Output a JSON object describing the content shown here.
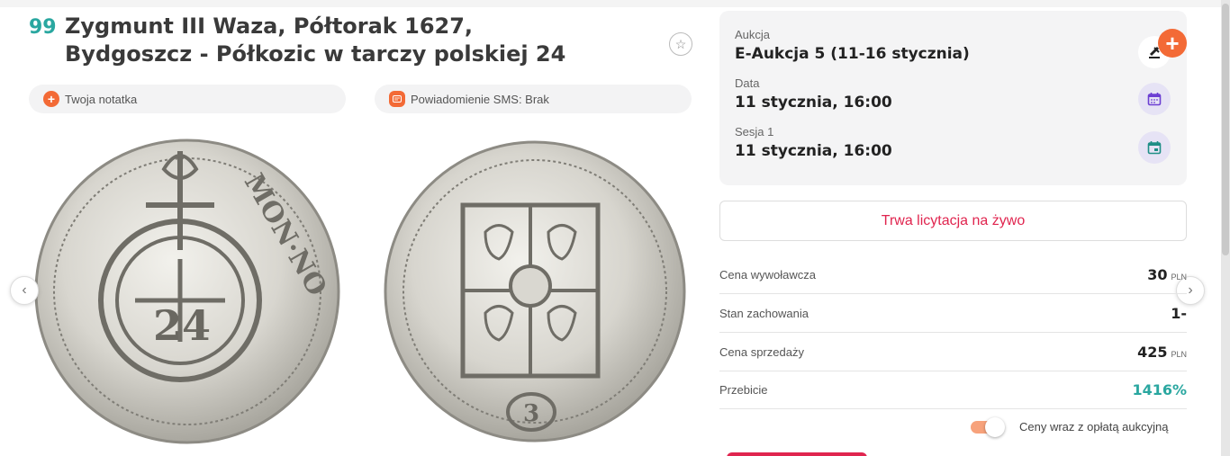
{
  "lot": {
    "number": "99",
    "title_line1": "Zygmunt III Waza, Półtorak 1627,",
    "title_line2": "Bydgoszcz - Półkozic w tarczy polskiej 24"
  },
  "actions": {
    "note_label": "Twoja notatka",
    "sms_label": "Powiadomienie SMS: Brak"
  },
  "images": {
    "obverse": "coin-obverse",
    "reverse": "coin-reverse"
  },
  "auction": {
    "auction_label": "Aukcja",
    "auction_value": "E-Aukcja 5 (11-16 stycznia)",
    "date_label": "Data",
    "date_value": "11 stycznia, 16:00",
    "session_label": "Sesja 1",
    "session_value": "11 stycznia, 16:00"
  },
  "live": {
    "label": "Trwa licytacja na żywo"
  },
  "prices": {
    "rows": [
      {
        "label": "Cena wywoławcza",
        "value": "30",
        "unit": "PLN"
      },
      {
        "label": "Stan zachowania",
        "value": "1-",
        "unit": ""
      },
      {
        "label": "Cena sprzedaży",
        "value": "425",
        "unit": "PLN"
      },
      {
        "label": "Przebicie",
        "value": "1416%",
        "unit": ""
      }
    ]
  },
  "toggle": {
    "label": "Ceny wraz z opłatą aukcyjną",
    "on": true
  },
  "colors": {
    "accent_orange": "#f36a36",
    "accent_teal": "#2aa7a0",
    "accent_red": "#e0254f"
  }
}
